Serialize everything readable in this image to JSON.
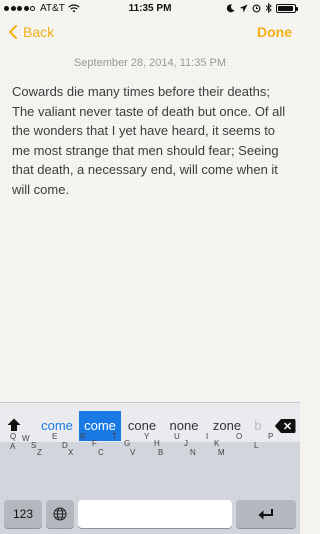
{
  "status_bar": {
    "carrier": "AT&T",
    "time": "11:35 PM",
    "battery_level": 0.85
  },
  "nav": {
    "back_label": "Back",
    "done_label": "Done"
  },
  "note": {
    "date": "September 28, 2014, 11:35 PM",
    "body": "Cowards die many times before their deaths; The valiant never taste of death but once. Of all the wonders that I yet have heard, it seems to me most strange that men should fear; Seeing that death, a necessary end, will come when it will come."
  },
  "keyboard": {
    "suggestions": [
      "come",
      "come",
      "cone",
      "none",
      "zone",
      "b"
    ],
    "row1": [
      "Q",
      "A",
      "W",
      "S",
      "Z",
      "E",
      "D",
      "X",
      "R",
      "C",
      "F",
      "T",
      "V",
      "G",
      "Y",
      "B",
      "H",
      "U",
      "N",
      "J",
      "I",
      "M",
      "K",
      "O",
      "L",
      "P"
    ],
    "numbers_label": "123"
  },
  "colors": {
    "accent": "#f2b015",
    "suggestion_blue": "#1a7ae5",
    "keyboard_bg": "#d2d5db"
  }
}
